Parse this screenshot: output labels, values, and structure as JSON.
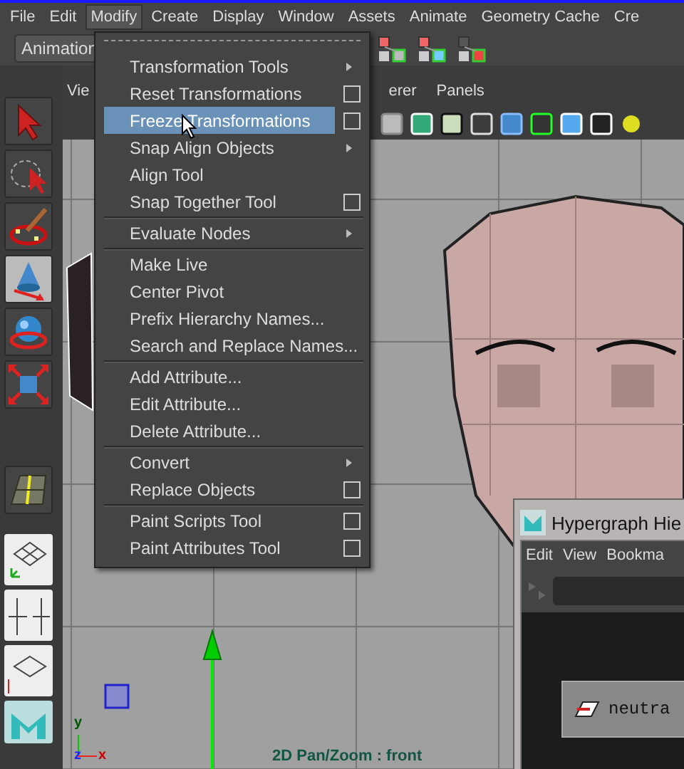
{
  "menubar": [
    {
      "label": "File",
      "selected": false
    },
    {
      "label": "Edit",
      "selected": false
    },
    {
      "label": "Modify",
      "selected": true
    },
    {
      "label": "Create",
      "selected": false
    },
    {
      "label": "Display",
      "selected": false
    },
    {
      "label": "Window",
      "selected": false
    },
    {
      "label": "Assets",
      "selected": false
    },
    {
      "label": "Animate",
      "selected": false
    },
    {
      "label": "Geometry Cache",
      "selected": false
    },
    {
      "label": "Cre",
      "selected": false
    }
  ],
  "toolbar": {
    "mode": "Animation"
  },
  "panel_menu": [
    "Vie",
    "erer",
    "Panels"
  ],
  "dropdown": {
    "sections": [
      [
        {
          "label": "Transformation Tools",
          "kind": "submenu",
          "selected": false
        },
        {
          "label": "Reset Transformations",
          "kind": "option",
          "selected": false
        },
        {
          "label": "Freeze Transformations",
          "kind": "option",
          "selected": true
        },
        {
          "label": "Snap Align Objects",
          "kind": "submenu",
          "selected": false
        },
        {
          "label": "Align Tool",
          "kind": "plain",
          "selected": false
        },
        {
          "label": "Snap Together Tool",
          "kind": "option",
          "selected": false
        }
      ],
      [
        {
          "label": "Evaluate Nodes",
          "kind": "submenu",
          "selected": false
        }
      ],
      [
        {
          "label": "Make Live",
          "kind": "plain",
          "selected": false
        },
        {
          "label": "Center Pivot",
          "kind": "plain",
          "selected": false
        },
        {
          "label": "Prefix Hierarchy Names...",
          "kind": "plain",
          "selected": false
        },
        {
          "label": "Search and Replace Names...",
          "kind": "plain",
          "selected": false
        }
      ],
      [
        {
          "label": "Add Attribute...",
          "kind": "plain",
          "selected": false
        },
        {
          "label": "Edit Attribute...",
          "kind": "plain",
          "selected": false
        },
        {
          "label": "Delete Attribute...",
          "kind": "plain",
          "selected": false
        }
      ],
      [
        {
          "label": "Convert",
          "kind": "submenu",
          "selected": false
        },
        {
          "label": "Replace Objects",
          "kind": "option",
          "selected": false
        }
      ],
      [
        {
          "label": "Paint Scripts Tool",
          "kind": "option",
          "selected": false
        },
        {
          "label": "Paint Attributes Tool",
          "kind": "option",
          "selected": false
        }
      ]
    ]
  },
  "viewport": {
    "status": "2D Pan/Zoom : front",
    "axes": [
      "y",
      "z",
      "x"
    ]
  },
  "hypergraph": {
    "title": "Hypergraph Hie",
    "menu": [
      "Edit",
      "View",
      "Bookma"
    ],
    "node": "neutra"
  }
}
